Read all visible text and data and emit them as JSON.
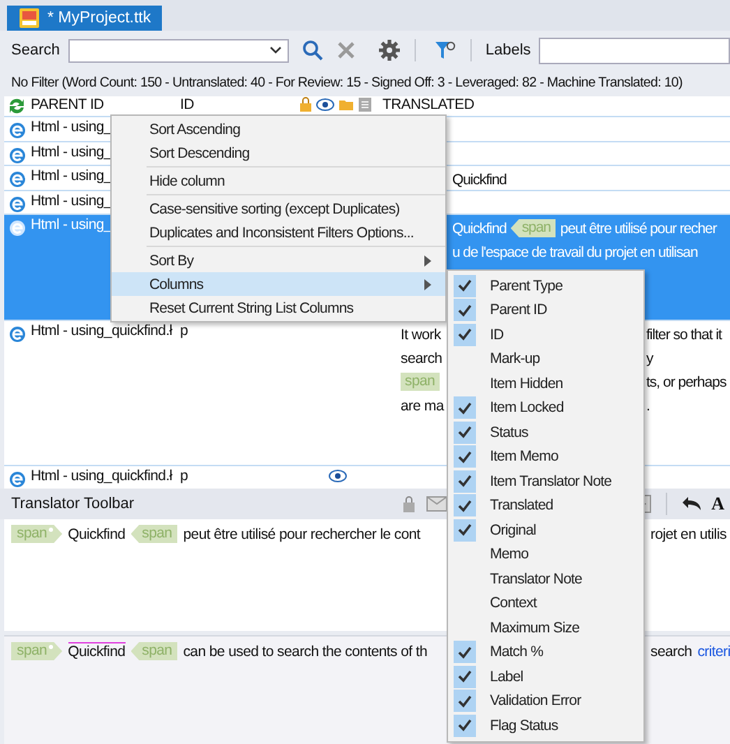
{
  "tab": {
    "title": "* MyProject.ttk",
    "selected": true
  },
  "toolbar": {
    "search_label": "Search",
    "labels_label": "Labels"
  },
  "filter_summary": "No Filter (Word Count: 150 - Untranslated: 40 - For Review: 15 - Signed Off: 3 - Leveraged: 82 - Machine Translated: 10)",
  "grid": {
    "columns": [
      "PARENT ID",
      "ID",
      "TRANSLATED"
    ],
    "rows": [
      {
        "parent_id": "Html - using_",
        "selected": false
      },
      {
        "parent_id": "Html - using_",
        "selected": false
      },
      {
        "parent_id": "Html - using_",
        "selected": false,
        "translated": [
          [
            {
              "kind": "text",
              "text": "Quickfind"
            }
          ]
        ]
      },
      {
        "parent_id": "Html - using_",
        "selected": false
      },
      {
        "parent_id": "Html - using_",
        "selected": true,
        "translated": [
          [
            {
              "kind": "text",
              "text": "Quickfind"
            },
            {
              "kind": "tag_close",
              "text": "span"
            },
            {
              "kind": "text",
              "text": "peut être utilisé pour recher"
            }
          ],
          [
            {
              "kind": "text",
              "text": "u de l'espace de travail du projet en utilisan"
            }
          ]
        ]
      },
      {
        "parent_id": "Html - using_quickfind.ł",
        "id": "p",
        "selected": false,
        "translated_left": [
          [
            {
              "kind": "text",
              "text": "It work"
            }
          ],
          [
            {
              "kind": "text",
              "text": "search"
            }
          ],
          [
            {
              "kind": "tag_close",
              "text": "span"
            }
          ],
          [
            {
              "kind": "text",
              "text": "are ma"
            }
          ]
        ],
        "translated_right": [
          [
            {
              "kind": "text",
              "text": "filter so that it"
            }
          ],
          [
            {
              "kind": "text",
              "text": "y"
            }
          ],
          [
            {
              "kind": "text",
              "text": "ts, or perhaps"
            }
          ],
          [
            {
              "kind": "text",
              "text": "."
            }
          ]
        ]
      },
      {
        "parent_id": "Html - using_quickfind.ł",
        "id": "p",
        "selected": false,
        "eye": true
      }
    ]
  },
  "translator_toolbar": {
    "title": "Translator Toolbar",
    "glyph": "A"
  },
  "target": {
    "left": [
      {
        "kind": "tag_open",
        "text": "span"
      },
      {
        "kind": "text",
        "text": "Quickfind"
      },
      {
        "kind": "tag_close",
        "text": "span"
      },
      {
        "kind": "text",
        "text": "peut être utilisé pour rechercher le cont"
      }
    ],
    "right": [
      {
        "kind": "text",
        "text": "rojet en utilis"
      }
    ]
  },
  "source": {
    "left": [
      {
        "kind": "tag_open",
        "text": "span"
      },
      {
        "kind": "text",
        "text": "Quickfind"
      },
      {
        "kind": "tag_close",
        "text": "span"
      },
      {
        "kind": "text",
        "text": "can be used to search the contents of th"
      }
    ],
    "right": [
      {
        "kind": "text",
        "text": "search"
      },
      {
        "kind": "term",
        "text": "criteri"
      }
    ]
  },
  "context_menu": [
    {
      "kind": "item",
      "label": "Sort Ascending",
      "highlighted": false
    },
    {
      "kind": "item",
      "label": "Sort Descending",
      "highlighted": false
    },
    {
      "kind": "separator"
    },
    {
      "kind": "item",
      "label": "Hide column",
      "highlighted": false
    },
    {
      "kind": "separator"
    },
    {
      "kind": "item",
      "label": "Case-sensitive sorting (except Duplicates)",
      "highlighted": false
    },
    {
      "kind": "item",
      "label": "Duplicates and Inconsistent Filters Options...",
      "highlighted": false
    },
    {
      "kind": "separator"
    },
    {
      "kind": "submenu",
      "label": "Sort By",
      "highlighted": false
    },
    {
      "kind": "submenu",
      "label": "Columns",
      "highlighted": true
    },
    {
      "kind": "item",
      "label": "Reset Current String List Columns",
      "highlighted": false
    }
  ],
  "columns_menu": [
    {
      "label": "Parent Type",
      "checked": true
    },
    {
      "label": "Parent ID",
      "checked": true
    },
    {
      "label": "ID",
      "checked": true
    },
    {
      "label": "Mark-up",
      "checked": false
    },
    {
      "label": "Item Hidden",
      "checked": false
    },
    {
      "label": "Item Locked",
      "checked": true
    },
    {
      "label": "Status",
      "checked": true
    },
    {
      "label": "Item Memo",
      "checked": true
    },
    {
      "label": "Item Translator Note",
      "checked": true
    },
    {
      "label": "Translated",
      "checked": true
    },
    {
      "label": "Original",
      "checked": true
    },
    {
      "label": "Memo",
      "checked": false
    },
    {
      "label": "Translator Note",
      "checked": false
    },
    {
      "label": "Context",
      "checked": false
    },
    {
      "label": "Maximum Size",
      "checked": false
    },
    {
      "label": "Match %",
      "checked": true
    },
    {
      "label": "Label",
      "checked": true
    },
    {
      "label": "Validation Error",
      "checked": true
    },
    {
      "label": "Flag Status",
      "checked": true
    }
  ]
}
